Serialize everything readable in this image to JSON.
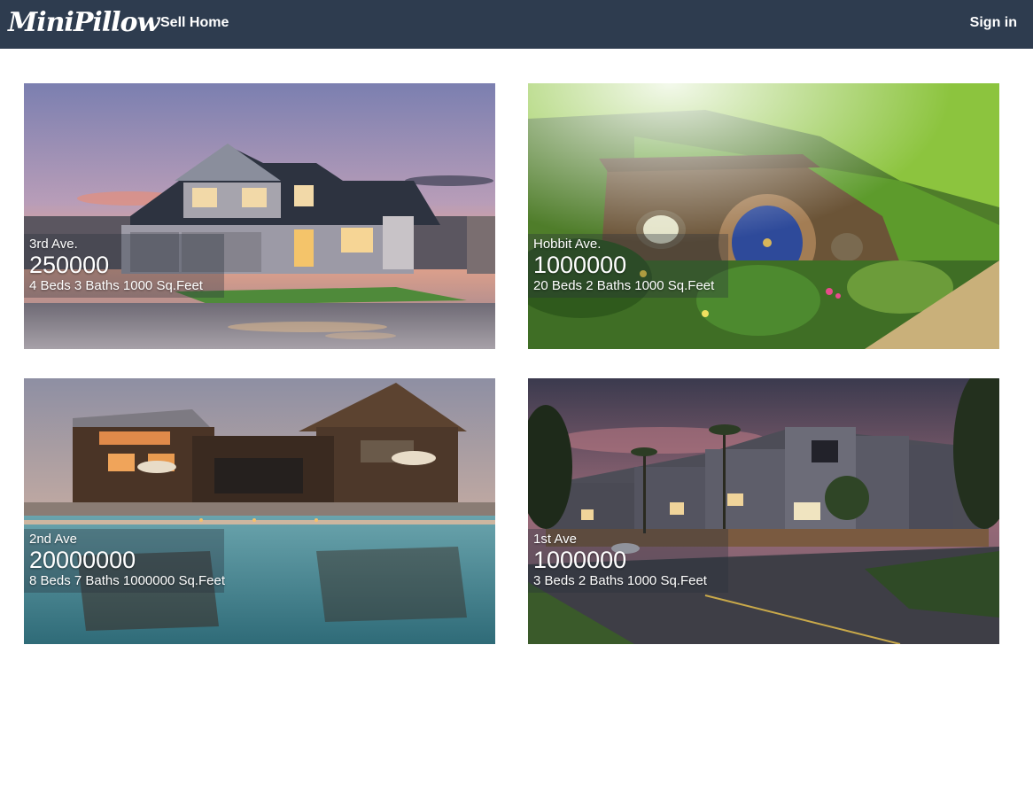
{
  "header": {
    "logo": "MiniPillow",
    "sell_link": "Sell Home",
    "signin_link": "Sign in"
  },
  "listings": [
    {
      "street": "3rd Ave.",
      "price": "250000",
      "details": "4 Beds 3 Baths 1000 Sq.Feet",
      "photo": "suburban-house-photo"
    },
    {
      "street": "Hobbit Ave.",
      "price": "1000000",
      "details": "20 Beds 2 Baths 1000 Sq.Feet",
      "photo": "hobbit-hole-photo"
    },
    {
      "street": "2nd Ave",
      "price": "20000000",
      "details": "8 Beds 7 Baths 1000000 Sq.Feet",
      "photo": "lodge-pool-photo"
    },
    {
      "street": "1st Ave",
      "price": "1000000",
      "details": "3 Beds 2 Baths 1000 Sq.Feet",
      "photo": "townhouses-photo"
    }
  ]
}
